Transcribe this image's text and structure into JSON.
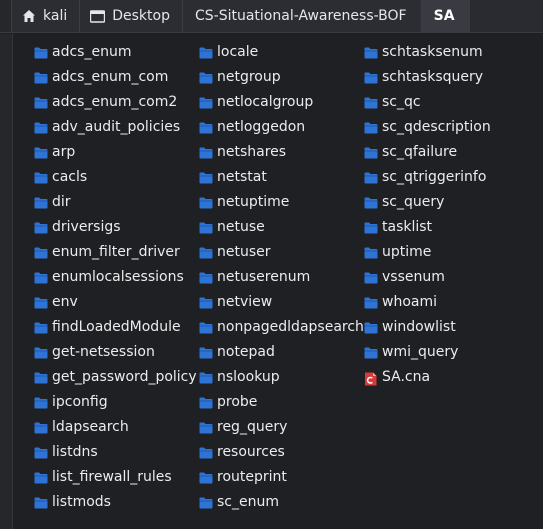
{
  "breadcrumb": {
    "items": [
      {
        "label": "kali",
        "icon": "home-icon"
      },
      {
        "label": "Desktop",
        "icon": "desktop-icon"
      },
      {
        "label": "CS-Situational-Awareness-BOF",
        "icon": null
      },
      {
        "label": "SA",
        "icon": null,
        "active": true
      }
    ]
  },
  "colors": {
    "folder": "#2e74d6",
    "background": "#1f2024",
    "text": "#ececec",
    "cna_icon": "#d63b3b"
  },
  "columns": [
    [
      {
        "name": "adcs_enum",
        "icon": "folder-icon"
      },
      {
        "name": "adcs_enum_com",
        "icon": "folder-icon"
      },
      {
        "name": "adcs_enum_com2",
        "icon": "folder-icon"
      },
      {
        "name": "adv_audit_policies",
        "icon": "folder-icon"
      },
      {
        "name": "arp",
        "icon": "folder-icon"
      },
      {
        "name": "cacls",
        "icon": "folder-icon"
      },
      {
        "name": "dir",
        "icon": "folder-icon"
      },
      {
        "name": "driversigs",
        "icon": "folder-icon"
      },
      {
        "name": "enum_filter_driver",
        "icon": "folder-icon"
      },
      {
        "name": "enumlocalsessions",
        "icon": "folder-icon"
      },
      {
        "name": "env",
        "icon": "folder-icon"
      },
      {
        "name": "findLoadedModule",
        "icon": "folder-icon"
      },
      {
        "name": "get-netsession",
        "icon": "folder-icon"
      },
      {
        "name": "get_password_policy",
        "icon": "folder-icon"
      },
      {
        "name": "ipconfig",
        "icon": "folder-icon"
      },
      {
        "name": "ldapsearch",
        "icon": "folder-icon"
      },
      {
        "name": "listdns",
        "icon": "folder-icon"
      },
      {
        "name": "list_firewall_rules",
        "icon": "folder-icon"
      },
      {
        "name": "listmods",
        "icon": "folder-icon"
      }
    ],
    [
      {
        "name": "locale",
        "icon": "folder-icon"
      },
      {
        "name": "netgroup",
        "icon": "folder-icon"
      },
      {
        "name": "netlocalgroup",
        "icon": "folder-icon"
      },
      {
        "name": "netloggedon",
        "icon": "folder-icon"
      },
      {
        "name": "netshares",
        "icon": "folder-icon"
      },
      {
        "name": "netstat",
        "icon": "folder-icon"
      },
      {
        "name": "netuptime",
        "icon": "folder-icon"
      },
      {
        "name": "netuse",
        "icon": "folder-icon"
      },
      {
        "name": "netuser",
        "icon": "folder-icon"
      },
      {
        "name": "netuserenum",
        "icon": "folder-icon"
      },
      {
        "name": "netview",
        "icon": "folder-icon"
      },
      {
        "name": "nonpagedldapsearch",
        "icon": "folder-icon"
      },
      {
        "name": "notepad",
        "icon": "folder-icon"
      },
      {
        "name": "nslookup",
        "icon": "folder-icon"
      },
      {
        "name": "probe",
        "icon": "folder-icon"
      },
      {
        "name": "reg_query",
        "icon": "folder-icon"
      },
      {
        "name": "resources",
        "icon": "folder-icon"
      },
      {
        "name": "routeprint",
        "icon": "folder-icon"
      },
      {
        "name": "sc_enum",
        "icon": "folder-icon"
      }
    ],
    [
      {
        "name": "schtasksenum",
        "icon": "folder-icon"
      },
      {
        "name": "schtasksquery",
        "icon": "folder-icon"
      },
      {
        "name": "sc_qc",
        "icon": "folder-icon"
      },
      {
        "name": "sc_qdescription",
        "icon": "folder-icon"
      },
      {
        "name": "sc_qfailure",
        "icon": "folder-icon"
      },
      {
        "name": "sc_qtriggerinfo",
        "icon": "folder-icon"
      },
      {
        "name": "sc_query",
        "icon": "folder-icon"
      },
      {
        "name": "tasklist",
        "icon": "folder-icon"
      },
      {
        "name": "uptime",
        "icon": "folder-icon"
      },
      {
        "name": "vssenum",
        "icon": "folder-icon"
      },
      {
        "name": "whoami",
        "icon": "folder-icon"
      },
      {
        "name": "windowlist",
        "icon": "folder-icon"
      },
      {
        "name": "wmi_query",
        "icon": "folder-icon"
      },
      {
        "name": "SA.cna",
        "icon": "cna-file-icon"
      }
    ]
  ]
}
